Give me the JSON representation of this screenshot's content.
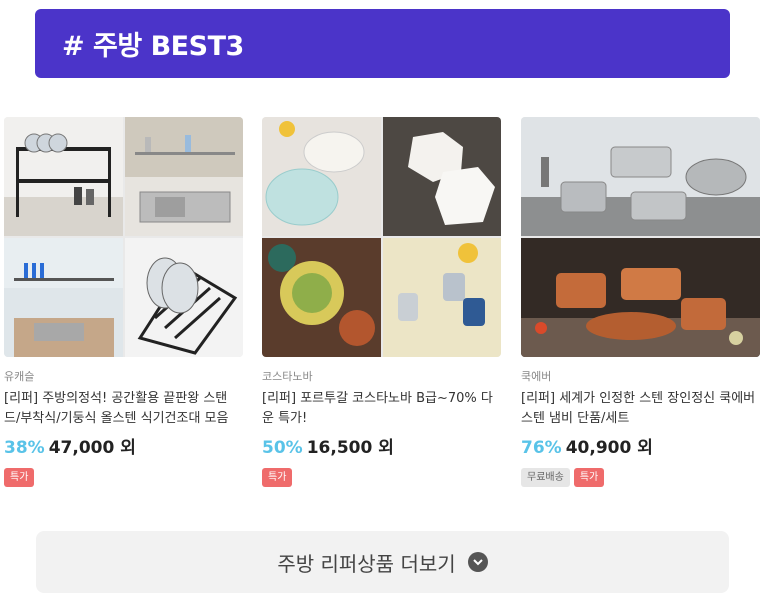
{
  "banner": {
    "title": "# 주방 BEST3"
  },
  "products": [
    {
      "image_icons": [
        "dish-rack-icon",
        "dish-rack-icon",
        "dish-rack-icon",
        "dish-rack-icon"
      ],
      "brand": "유캐슬",
      "name": "[리퍼] 주방의정석! 공간활용 끝판왕 스탠드/부착식/기둥식 올스텐 식기건조대 모음",
      "discount": "38%",
      "price": "47,000 외",
      "badges": [
        {
          "label": "특가",
          "kind": "red"
        }
      ]
    },
    {
      "image_icons": [
        "plate-icon",
        "plate-icon",
        "plate-icon",
        "cup-icon"
      ],
      "brand": "코스타노바",
      "name": "[리퍼] 포르투갈 코스타노바 B급~70% 다운 특가!",
      "discount": "50%",
      "price": "16,500 외",
      "badges": [
        {
          "label": "특가",
          "kind": "red"
        }
      ]
    },
    {
      "image_icons": [
        "pot-icon",
        "pot-icon"
      ],
      "brand": "쿡에버",
      "name": "[리퍼] 세계가 인정한 스텐 장인정신 쿡에버 스텐 냄비 단품/세트",
      "discount": "76%",
      "price": "40,900 외",
      "badges": [
        {
          "label": "무료배송",
          "kind": "gray"
        },
        {
          "label": "특가",
          "kind": "red"
        }
      ]
    }
  ],
  "more_button": {
    "label": "주방 리퍼상품 더보기",
    "icon": "chevron-down-icon"
  },
  "colors": {
    "banner": "#4b34c9",
    "discount": "#59c3e8",
    "special_badge": "#ef6b6b"
  }
}
